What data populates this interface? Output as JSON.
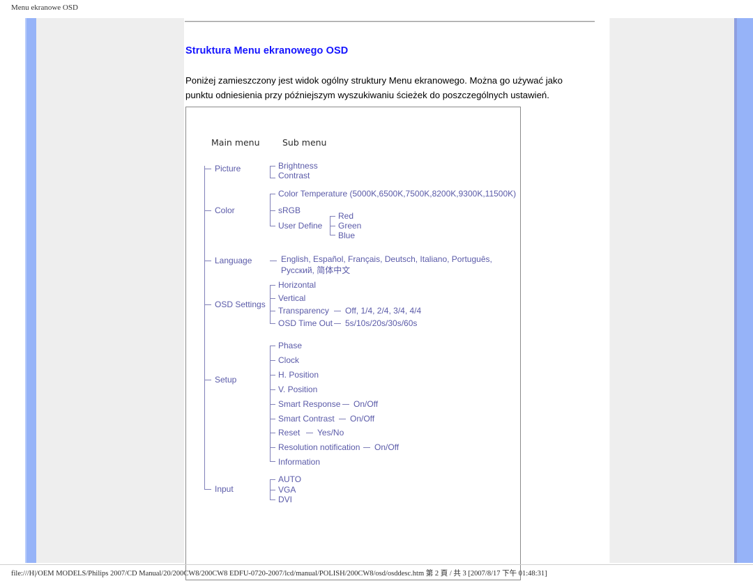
{
  "print_header": "Menu ekranowe OSD",
  "content": {
    "title": "Struktura Menu ekranowego OSD",
    "intro": "Poniżej zamieszczony jest widok ogólny struktury Menu ekranowego. Można go używać jako punktu odniesienia przy późniejszym wyszukiwaniu ścieżek do poszczególnych ustawień."
  },
  "diagram": {
    "col_main_label": "Main menu",
    "col_sub_label": "Sub menu",
    "groups": [
      {
        "name": "Picture",
        "items": [
          {
            "label": "Brightness",
            "values": ""
          },
          {
            "label": "Contrast",
            "values": ""
          }
        ]
      },
      {
        "name": "Color",
        "items": [
          {
            "label": "Color Temperature (5000K,6500K,7500K,8200K,9300K,11500K)",
            "values": ""
          },
          {
            "label": "sRGB",
            "values": ""
          },
          {
            "label": "User Define",
            "values": "",
            "children": [
              "Red",
              "Green",
              "Blue"
            ]
          }
        ]
      },
      {
        "name": "Language",
        "items": [
          {
            "label": "English, Español, Français, Deutsch, Italiano, Português,",
            "values": ""
          },
          {
            "label": "Русский, 简体中文",
            "values": ""
          }
        ]
      },
      {
        "name": "OSD Settings",
        "items": [
          {
            "label": "Horizontal",
            "values": ""
          },
          {
            "label": "Vertical",
            "values": ""
          },
          {
            "label": "Transparency",
            "values": "Off, 1/4, 2/4, 3/4, 4/4"
          },
          {
            "label": "OSD Time Out",
            "values": "5s/10s/20s/30s/60s"
          }
        ]
      },
      {
        "name": "Setup",
        "items": [
          {
            "label": "Phase",
            "values": ""
          },
          {
            "label": "Clock",
            "values": ""
          },
          {
            "label": "H. Position",
            "values": ""
          },
          {
            "label": "V. Position",
            "values": ""
          },
          {
            "label": "Smart Response",
            "values": "On/Off"
          },
          {
            "label": "Smart Contrast",
            "values": "On/Off"
          },
          {
            "label": "Reset",
            "values": "Yes/No"
          },
          {
            "label": "Resolution notification",
            "values": "On/Off"
          },
          {
            "label": "Information",
            "values": ""
          }
        ]
      },
      {
        "name": "Input",
        "items": [
          {
            "label": "AUTO",
            "values": ""
          },
          {
            "label": "VGA",
            "values": ""
          },
          {
            "label": "DVI",
            "values": ""
          }
        ]
      }
    ]
  },
  "footer": {
    "path": "file:///H|/OEM MODELS/Philips 2007/CD Manual/20/200CW8/200CW8 EDFU-0720-2007/lcd/manual/POLISH/200CW8/osd/osddesc.htm 第 2 頁 / 共 3 [2007/8/17 下午 01:48:31]"
  },
  "colors": {
    "title_blue": "#1414ff",
    "diagram_text": "#5a5aa8",
    "rail_blue": "#96b3f8",
    "panel_gray": "#eeeeee"
  }
}
